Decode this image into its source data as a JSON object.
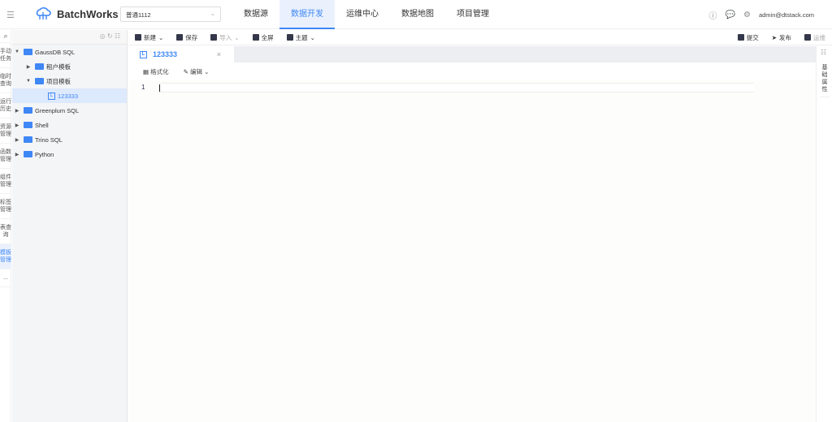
{
  "app": {
    "name": "BatchWorks",
    "project": "普通1112"
  },
  "nav": [
    "数据源",
    "数据开发",
    "运维中心",
    "数据地图",
    "项目管理"
  ],
  "user": "admin@dtstack.com",
  "sidebar": [
    "手动任务",
    "临时查询",
    "运行历史",
    "资源管理",
    "函数管理",
    "组件管理",
    "标签管理",
    "表查询",
    "模板管理",
    "..."
  ],
  "tree": {
    "root1": "GaussDB SQL",
    "c1": "租户模板",
    "c2": "项目模板",
    "file": "123333",
    "others": [
      "Greenplum SQL",
      "Shell",
      "Trino SQL",
      "Python"
    ]
  },
  "toolbar": {
    "new": "新建",
    "save": "保存",
    "import": "导入",
    "fullscreen": "全屏",
    "theme": "主题",
    "submit": "提交",
    "publish": "发布",
    "ops": "运维"
  },
  "tab": {
    "label": "123333",
    "file_icon": "L"
  },
  "editor": {
    "format": "格式化",
    "edit": "编辑",
    "line": "1"
  },
  "right": {
    "props": "基础属性"
  }
}
